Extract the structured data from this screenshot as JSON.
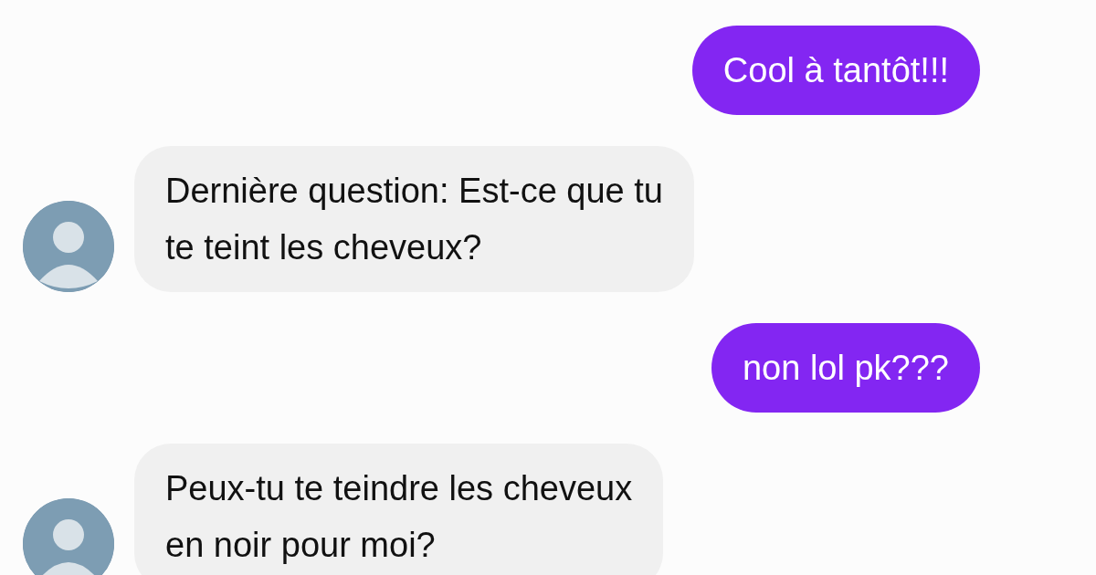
{
  "messages": [
    {
      "kind": "sent",
      "text": "Cool à tantôt!!!"
    },
    {
      "kind": "received",
      "text": "Dernière question: Est-ce que tu\nte teint les cheveux?"
    },
    {
      "kind": "sent",
      "text": "non lol pk???"
    },
    {
      "kind": "received",
      "text": "Peux-tu te teindre les cheveux\nen noir pour moi?"
    }
  ]
}
